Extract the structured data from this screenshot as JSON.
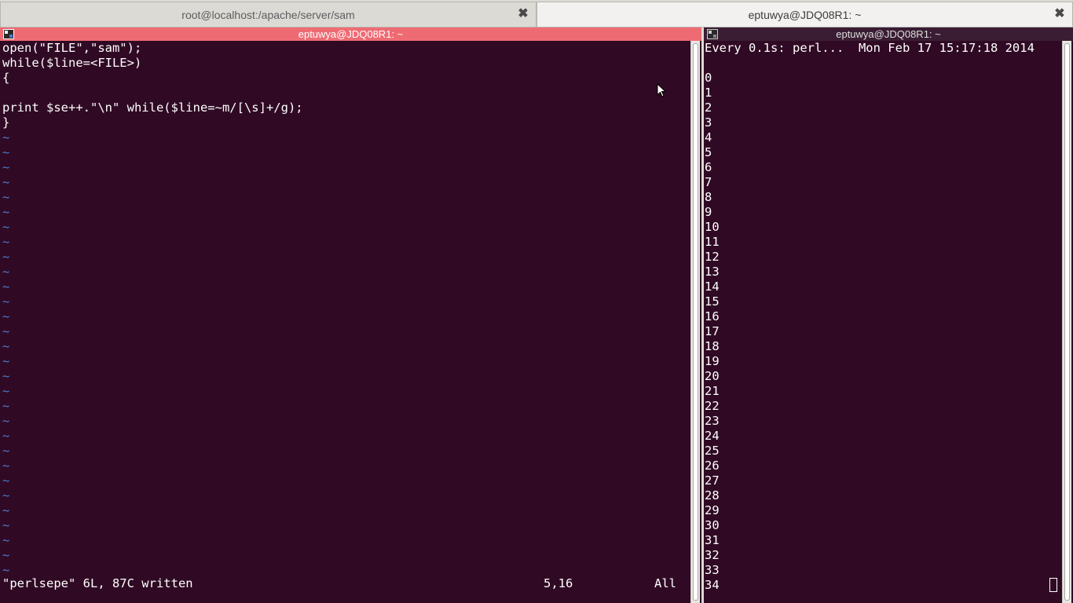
{
  "tabs": [
    {
      "label": "root@localhost:/apache/server/sam",
      "active": false
    },
    {
      "label": "eptuwya@JDQ08R1: ~",
      "active": true
    }
  ],
  "left_pane": {
    "title": "eptuwya@JDQ08R1: ~",
    "code_lines": [
      "open(\"FILE\",\"sam\");",
      "while($line=<FILE>)",
      "{",
      "",
      "print $se++.\"\\n\" while($line=~m/[\\s]+/g);",
      "}"
    ],
    "tilde_glyph": "~",
    "status": {
      "message": "\"perlsepe\" 6L, 87C written",
      "position": "5,16",
      "scroll": "All"
    }
  },
  "right_pane": {
    "title": "eptuwya@JDQ08R1: ~",
    "header": "Every 0.1s: perl...  Mon Feb 17 15:17:18 2014",
    "output_lines": [
      "0",
      "1",
      "2",
      "3",
      "4",
      "5",
      "6",
      "7",
      "8",
      "9",
      "10",
      "11",
      "12",
      "13",
      "14",
      "15",
      "16",
      "17",
      "18",
      "19",
      "20",
      "21",
      "22",
      "23",
      "24",
      "25",
      "26",
      "27",
      "28",
      "29",
      "30",
      "31",
      "32",
      "33",
      "34"
    ]
  },
  "colors": {
    "terminal_bg": "#300a24",
    "active_pane_title": "#ef6b73",
    "tilde": "#4a7bd0"
  }
}
